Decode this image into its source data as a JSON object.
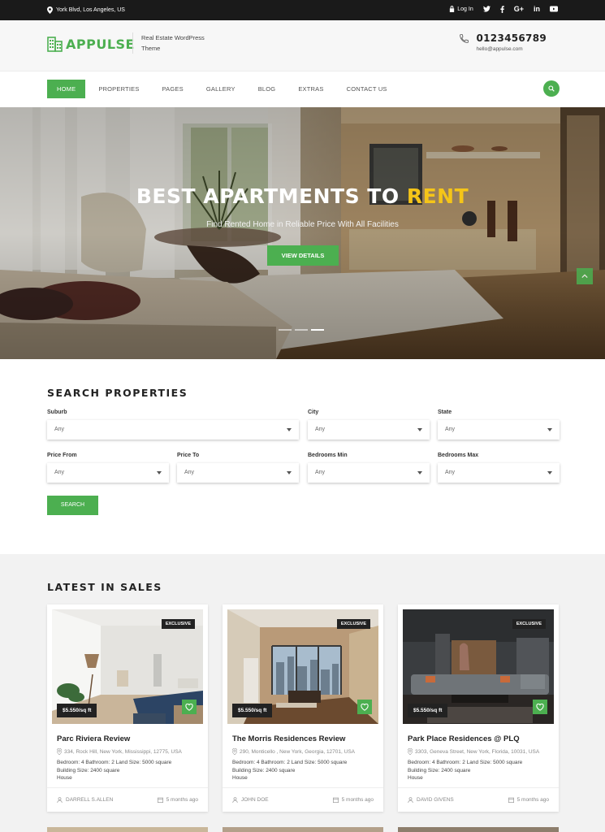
{
  "topbar": {
    "address": "York Blvd, Los Angeles, US",
    "login": "Log In",
    "social": [
      "twitter-icon",
      "facebook-icon",
      "google-plus-icon",
      "linkedin-icon",
      "youtube-icon"
    ],
    "google_plus": "G+",
    "linkedin": "in"
  },
  "header": {
    "logo": "APPULSE",
    "tagline": "Real Estate WordPress Theme",
    "phone": "0123456789",
    "email": "hello@appulse.com"
  },
  "nav": {
    "items": [
      "HOME",
      "PROPERTIES",
      "PAGES",
      "GALLERY",
      "BLOG",
      "EXTRAS",
      "CONTACT US"
    ],
    "active": "HOME"
  },
  "hero": {
    "title_main": "BEST APARTMENTS TO ",
    "title_highlight": "RENT",
    "subtitle": "Find Rented Home in Reliable Price With All Facilities",
    "button": "VIEW DETAILS",
    "slides": 3,
    "active_slide": 3
  },
  "search": {
    "heading": "SEARCH PROPERTIES",
    "fields": [
      {
        "label": "Suburb",
        "value": "Any"
      },
      {
        "label": "City",
        "value": "Any"
      },
      {
        "label": "State",
        "value": "Any"
      },
      {
        "label": "Price From",
        "value": "Any"
      },
      {
        "label": "Price To",
        "value": "Any"
      },
      {
        "label": "Bedrooms Min",
        "value": "Any"
      },
      {
        "label": "Bedrooms Max",
        "value": "Any"
      }
    ],
    "button": "SEARCH"
  },
  "sales": {
    "heading": "LATEST IN SALES",
    "cards": [
      {
        "badge": "EXCLUSIVE",
        "price": "$5.550/sq ft",
        "title": "Parc Riviera Review",
        "address": "334, Rock Hill, New York, Mississippi, 12775, USA",
        "specs": "Bedroom: 4   Bathroom: 2   Land Size: 5000 square",
        "building": "Building Size: 2400 square",
        "type": "House",
        "author": "DARRELL S.ALLEN",
        "time": "5 months ago"
      },
      {
        "badge": "EXCLUSIVE",
        "price": "$5.550/sq ft",
        "title": "The Morris Residences Review",
        "address": "290, Monticello , New York, Georgia, 12701, USA",
        "specs": "Bedroom: 4   Bathroom: 2   Land Size: 5000 square",
        "building": "Building Size: 2400 square",
        "type": "House",
        "author": "JOHN DOE",
        "time": "5 months ago"
      },
      {
        "badge": "EXCLUSIVE",
        "price": "$5.550/sq ft",
        "title": "Park Place Residences @ PLQ",
        "address": "3303, Geneva Street, New York, Florida, 10031, USA",
        "specs": "Bedroom: 4   Bathroom: 2   Land Size: 5000 square",
        "building": "Building Size: 2400 square",
        "type": "House",
        "author": "DAVID GIVENS",
        "time": "5 months ago"
      }
    ]
  },
  "colors": {
    "accent": "#4caf50",
    "highlight": "#f5c518",
    "dark": "#1a1a1a"
  }
}
